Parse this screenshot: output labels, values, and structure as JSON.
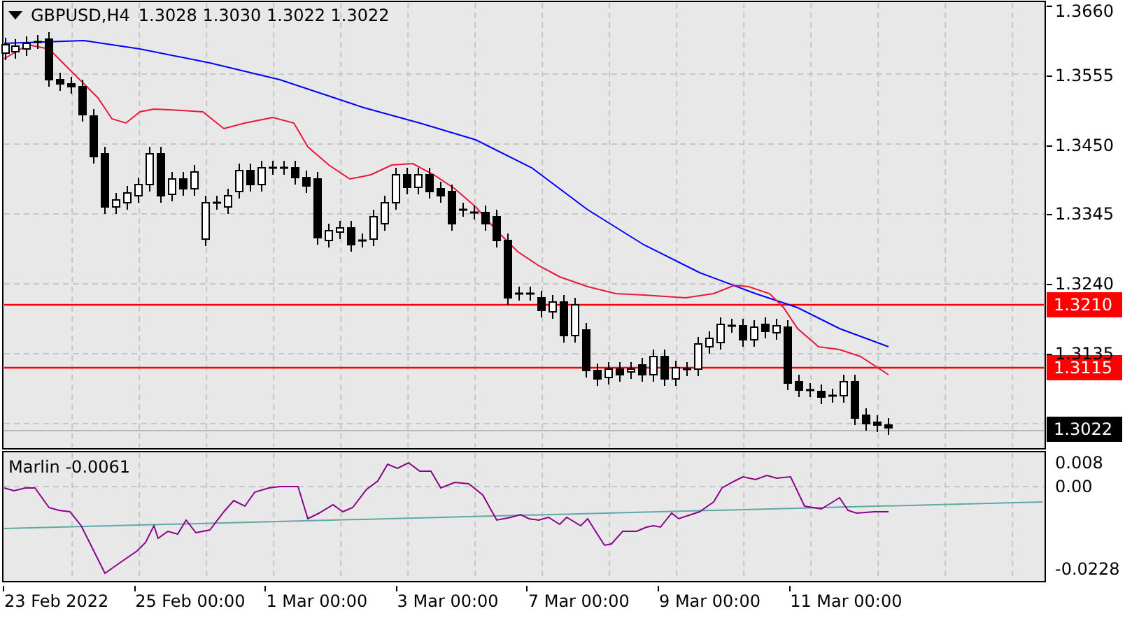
{
  "chart": {
    "title": "GBPUSD,H4",
    "ohlc": "1.3028 1.3030 1.3022 1.3022",
    "price_axis": [
      "1.3660",
      "1.3555",
      "1.3450",
      "1.3345",
      "1.3240",
      "1.3135"
    ],
    "levels": [
      {
        "label": "1.3210"
      },
      {
        "label": "1.3115"
      }
    ],
    "current_price": "1.3022"
  },
  "indicator": {
    "label": "Marlin -0.0061",
    "axis": [
      "0.008",
      "0.00",
      "-0.0228"
    ]
  },
  "time_axis": [
    "23 Feb 2022",
    "25 Feb 00:00",
    "1 Mar 00:00",
    "3 Mar 00:00",
    "7 Mar 00:00",
    "9 Mar 00:00",
    "11 Mar 00:00"
  ]
}
